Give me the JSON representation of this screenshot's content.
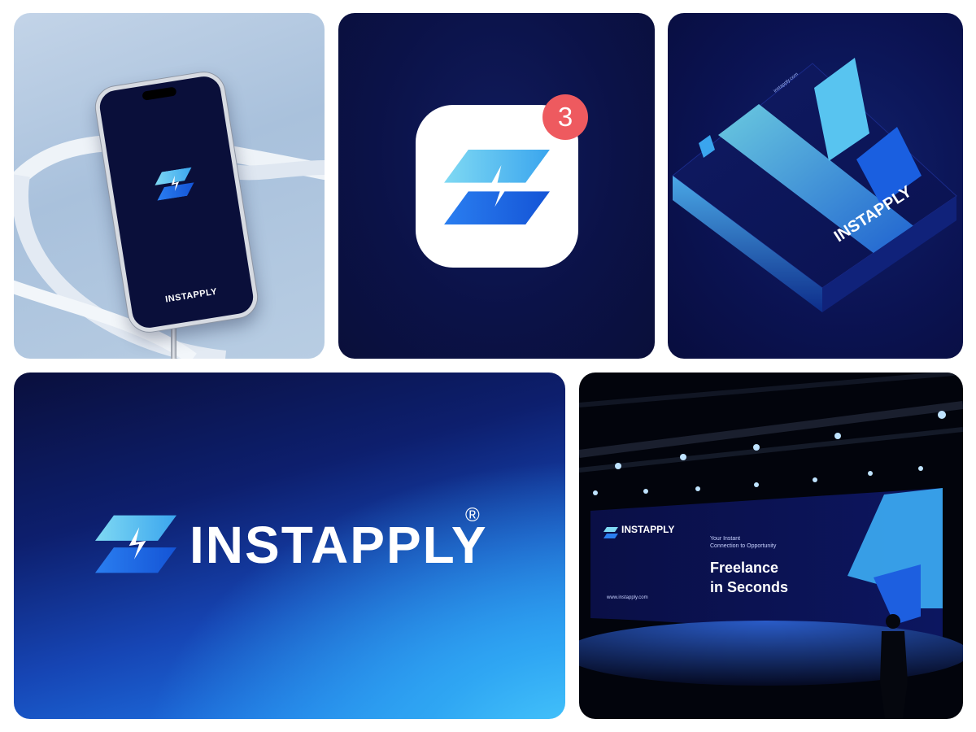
{
  "phone_mockup": {
    "brand_label": "INSTAPPLY",
    "icon": "instapply-bolt-logo"
  },
  "app_icon": {
    "notification_count": "3",
    "icon": "instapply-bolt-logo",
    "badge_color": "#ee5a5f"
  },
  "box_packaging": {
    "brand_label": "INSTAPPLY",
    "url": "instapply.com"
  },
  "logo_lockup": {
    "wordmark": "INSTAPPLY",
    "registered_mark": "®"
  },
  "stage_screen": {
    "brand": "INSTAPPLY",
    "tagline_line1": "Your Instant",
    "tagline_line2": "Connection to Opportunity",
    "headline_line1": "Freelance",
    "headline_line2": "in Seconds",
    "url": "www.instapply.com"
  },
  "colors": {
    "navy": "#0a0f3a",
    "brand_blue": "#1d6fe0",
    "light_blue": "#58c4f0",
    "cyan": "#4fd3ff"
  }
}
